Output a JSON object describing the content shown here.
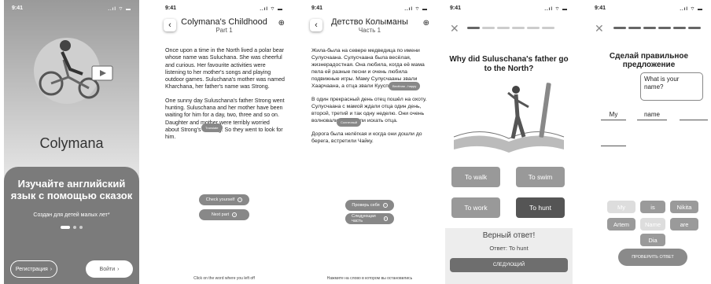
{
  "status": {
    "time": "9:41",
    "icons": "..ıl ⌔ ▬"
  },
  "welcome": {
    "logo": "Colymana",
    "headline": "Изучайте английский язык с помощью сказок",
    "subtitle": "Создан для детей малых лет*",
    "register": "Регистрация",
    "login": "Войти",
    "arrow": "›"
  },
  "reading_en": {
    "title": "Colymana's Childhood",
    "part": "Part 1",
    "back": "‹",
    "globe": "⊕",
    "p1": "Once upon a time in the North lived a polar bear whose name was Suluchana. She was cheerful and curious. Her favourite activities were listening to her mother's songs and playing outdoor games. Suluchana's mother was named Kharchana, her father's name was Strong.",
    "pill": "Translate",
    "p2": "One sunny day Suluschana's father Strong went hunting. Suluschana and her mother have been waiting for him for a day, two, three and so on. Daughter and mother were terribly worried about Strong's missing. So they went to look for him.",
    "check": "Check yourself",
    "next": "Next part",
    "footer": "Click on the word where you left off"
  },
  "reading_ru": {
    "title": "Детство Колыманы",
    "part": "Часть 1",
    "back": "‹",
    "globe": "⊕",
    "p1": "Жила-была на севере медведица по имени Сулусчаана. Сулусчаана была весёлая, жизнерадостная. Она любила, когда её мама пела ей разные песни и очень любила подвижные игры. Маму Сулусчааны звали Хаарчаана, а отца звали Кууспах.",
    "pill1": "Весёлая - happy",
    "pill2": "Солнечный",
    "p2": "В один прекрасный день отец пошёл на охоту. Сулусчаана с мамой ждали отца один день, второй, третий и так одну неделю. Они очень волновались и пошли искать отца.",
    "p3": "Дорога была нелёгкая и когда они дошли до берега, встретили Чайку.",
    "check": "Проверь себя",
    "next": "Следующая часть",
    "footer": "Нажмите на слово в котором вы остановились"
  },
  "quiz1": {
    "close": "✕",
    "question": "Why did Suluschana's father go to the North?",
    "options": [
      "To walk",
      "To swim",
      "To work",
      "To hunt"
    ],
    "result_title": "Верный ответ!",
    "result_label": "Ответ:",
    "result_answer": "To hunt",
    "next": "СЛЕДУЮЩИЙ"
  },
  "quiz2": {
    "close": "✕",
    "question": "Сделай правильное предложение",
    "prompt": "What is your name?",
    "slots": [
      "My",
      "name",
      "",
      ""
    ],
    "chips": [
      "My",
      "is",
      "Nikita",
      "Artem",
      "Name",
      "are",
      "Dia"
    ],
    "check": "ПРОВЕРИТЬ ОТВЕТ"
  }
}
